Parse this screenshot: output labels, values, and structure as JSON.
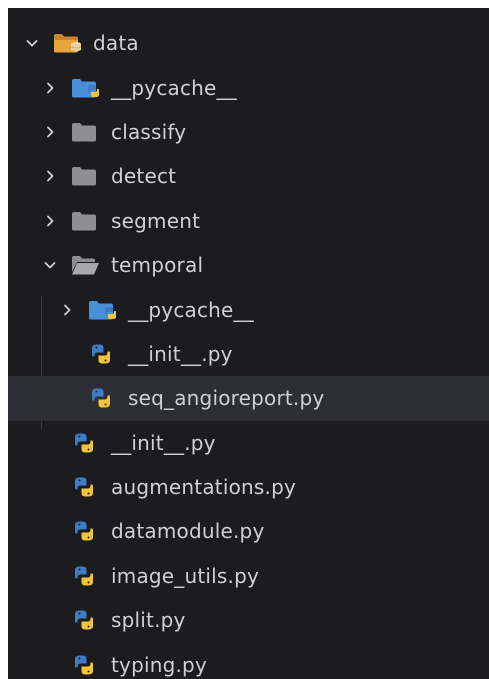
{
  "explorer": {
    "root": {
      "label": "data",
      "expanded": true
    },
    "items": [
      {
        "label": "__pycache__",
        "type": "pycache-folder",
        "expanded": false
      },
      {
        "label": "classify",
        "type": "folder",
        "expanded": false
      },
      {
        "label": "detect",
        "type": "folder",
        "expanded": false
      },
      {
        "label": "segment",
        "type": "folder",
        "expanded": false
      },
      {
        "label": "temporal",
        "type": "folder",
        "expanded": true
      },
      {
        "label": "__pycache__",
        "type": "pycache-folder",
        "expanded": false
      },
      {
        "label": "__init__.py",
        "type": "python-file"
      },
      {
        "label": "seq_angioreport.py",
        "type": "python-file",
        "selected": true
      },
      {
        "label": "__init__.py",
        "type": "python-file"
      },
      {
        "label": "augmentations.py",
        "type": "python-file"
      },
      {
        "label": "datamodule.py",
        "type": "python-file"
      },
      {
        "label": "image_utils.py",
        "type": "python-file"
      },
      {
        "label": "split.py",
        "type": "python-file"
      },
      {
        "label": "typing.py",
        "type": "python-file"
      }
    ]
  },
  "colors": {
    "background": "#1c1c1f",
    "text": "#cfd0d4",
    "selected_row": "#2e2f34",
    "folder_gray": "#8e8e93",
    "pycache_blue": "#4a90d9",
    "python_blue": "#3f7cc4",
    "python_yellow": "#f2c43a",
    "data_folder_orange": "#e8a53a"
  }
}
